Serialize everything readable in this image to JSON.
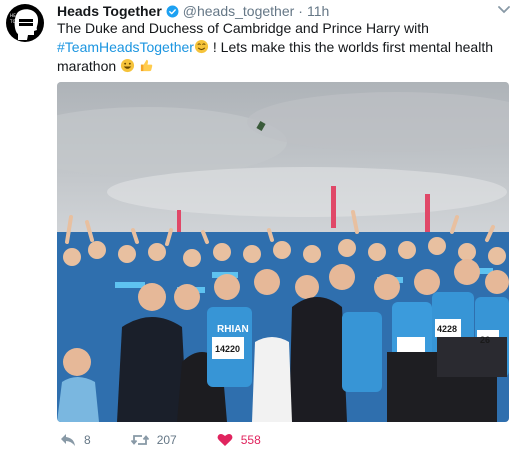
{
  "tweet": {
    "author_name": "Heads Together",
    "handle": "@heads_together",
    "separator": "·",
    "time": "11h",
    "avatar_logo_text": "HEADS TOGETHER",
    "text_part1": "The Duke and Duchess of Cambridge and Prince Harry with",
    "hashtag": "#TeamHeadsTogether",
    "text_part2": "! Lets make this the worlds first mental health",
    "text_part3": "marathon",
    "photo_bib_1": "RHIAN",
    "photo_bib_2": "14220",
    "photo_bib_3": "4228",
    "photo_bib_4": "26"
  },
  "actions": {
    "reply_count": "8",
    "retweet_count": "207",
    "like_count": "558"
  },
  "colors": {
    "link": "#1b95e0",
    "like": "#e0245e",
    "muted": "#657786",
    "team_shirt": "#2f8fd0"
  },
  "icons": [
    "avatar-logo",
    "verified-badge-icon",
    "caret-down-icon",
    "smiling-face-icon",
    "grinning-face-icon",
    "thumbs-up-icon",
    "reply-icon",
    "retweet-icon",
    "heart-icon"
  ]
}
